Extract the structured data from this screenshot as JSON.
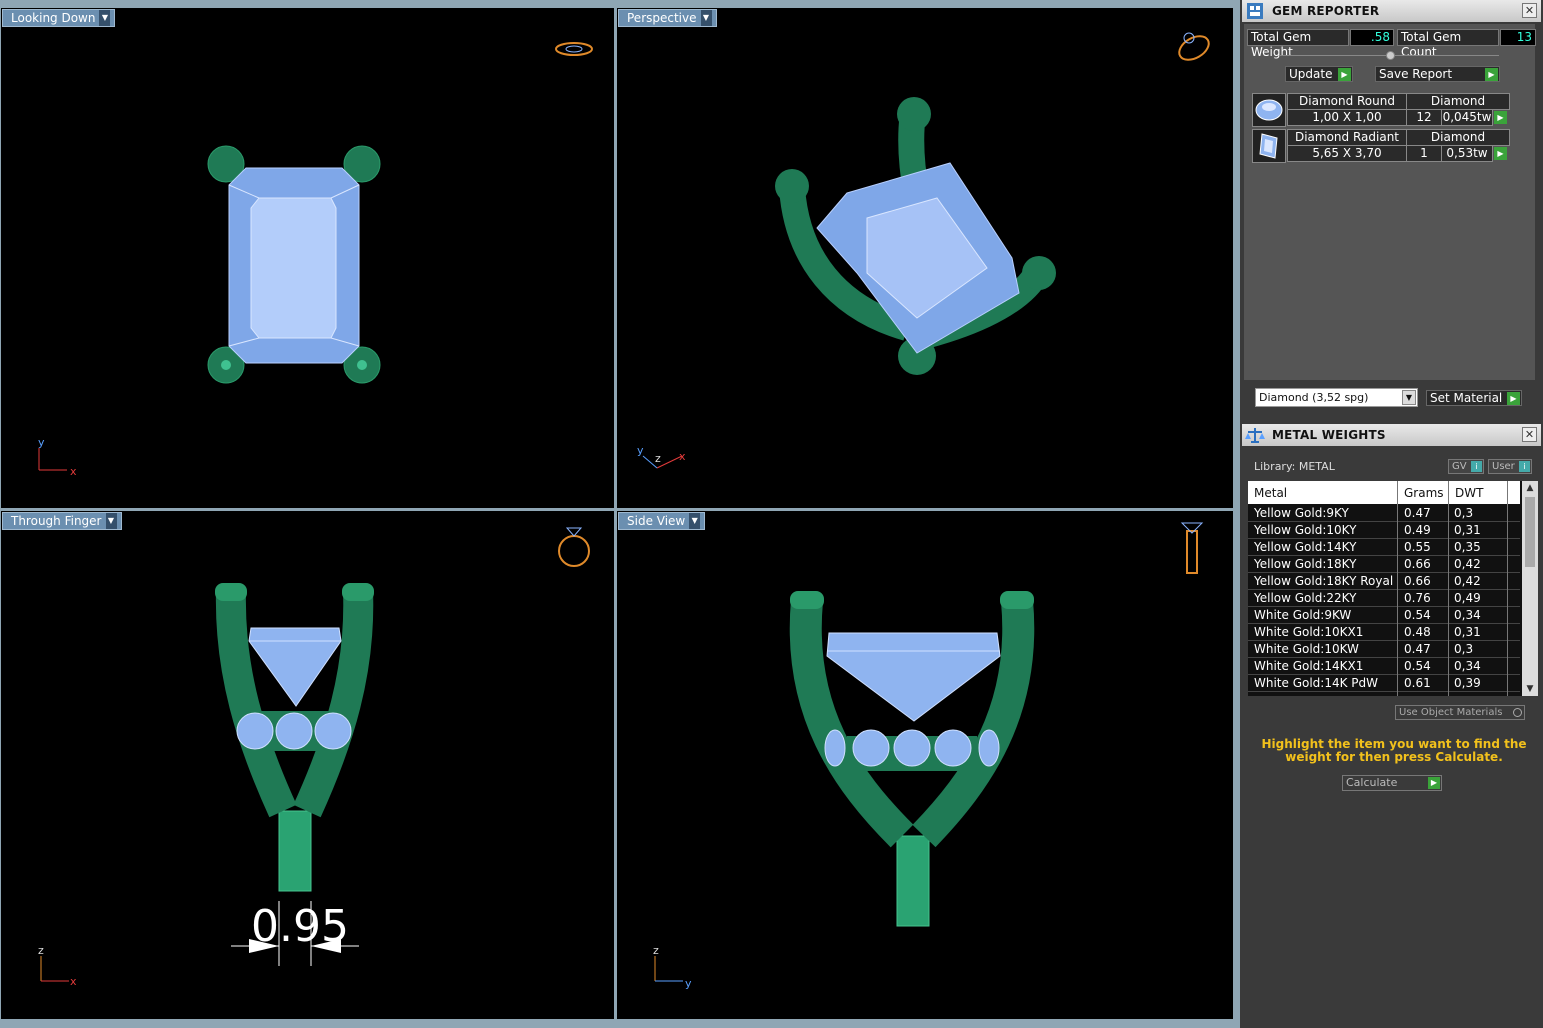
{
  "viewports": {
    "top": {
      "label": "Looking Down",
      "axis1": "y",
      "axis2": "x"
    },
    "perspective": {
      "label": "Perspective",
      "axis1": "y",
      "axis2": "z",
      "axis3": "x"
    },
    "front": {
      "label": "Through Finger",
      "axis1": "z",
      "axis2": "x",
      "dimension": "0.95"
    },
    "side": {
      "label": "Side View",
      "axis1": "z",
      "axis2": "y"
    }
  },
  "gem_reporter": {
    "title": "GEM REPORTER",
    "total_weight_label": "Total Gem Weight",
    "total_weight_value": ".58",
    "total_count_label": "Total Gem Count",
    "total_count_value": "13",
    "update_label": "Update",
    "save_report_label": "Save Report",
    "gems": [
      {
        "name": "Diamond Round",
        "material": "Diamond",
        "size": "1,00 X 1,00",
        "count": "12",
        "weight": "0,045tw"
      },
      {
        "name": "Diamond Radiant",
        "material": "Diamond",
        "size": "5,65 X 3,70",
        "count": "1",
        "weight": "0,53tw"
      }
    ],
    "material_select": "Diamond     (3,52 spg)",
    "set_material_label": "Set Material"
  },
  "metal_weights": {
    "title": "METAL WEIGHTS",
    "library": "Library: METAL",
    "gv_label": "GV",
    "user_label": "User",
    "columns": [
      "Metal",
      "Grams",
      "DWT"
    ],
    "rows": [
      [
        "Yellow Gold:9KY",
        "0.47",
        "0,3"
      ],
      [
        "Yellow Gold:10KY",
        "0.49",
        "0,31"
      ],
      [
        "Yellow Gold:14KY",
        "0.55",
        "0,35"
      ],
      [
        "Yellow Gold:18KY",
        "0.66",
        "0,42"
      ],
      [
        "Yellow Gold:18KY Royal",
        "0.66",
        "0,42"
      ],
      [
        "Yellow Gold:22KY",
        "0.76",
        "0,49"
      ],
      [
        "White Gold:9KW",
        "0.54",
        "0,34"
      ],
      [
        "White Gold:10KX1",
        "0.48",
        "0,31"
      ],
      [
        "White Gold:10KW",
        "0.47",
        "0,3"
      ],
      [
        "White Gold:14KX1",
        "0.54",
        "0,34"
      ],
      [
        "White Gold:14K PdW",
        "0.61",
        "0,39"
      ]
    ],
    "use_object_materials": "Use Object Materials",
    "hint": "Highlight the item you want to find the weight for then press Calculate.",
    "calculate_label": "Calculate"
  },
  "colors": {
    "viewport_bg": "#000000",
    "metal_green": "#1f7a55",
    "gem_blue": "#8fb4f0",
    "label_blue": "#6b8fb0",
    "accent_green": "#3aa33a",
    "hint_yellow": "#f2c11c"
  }
}
